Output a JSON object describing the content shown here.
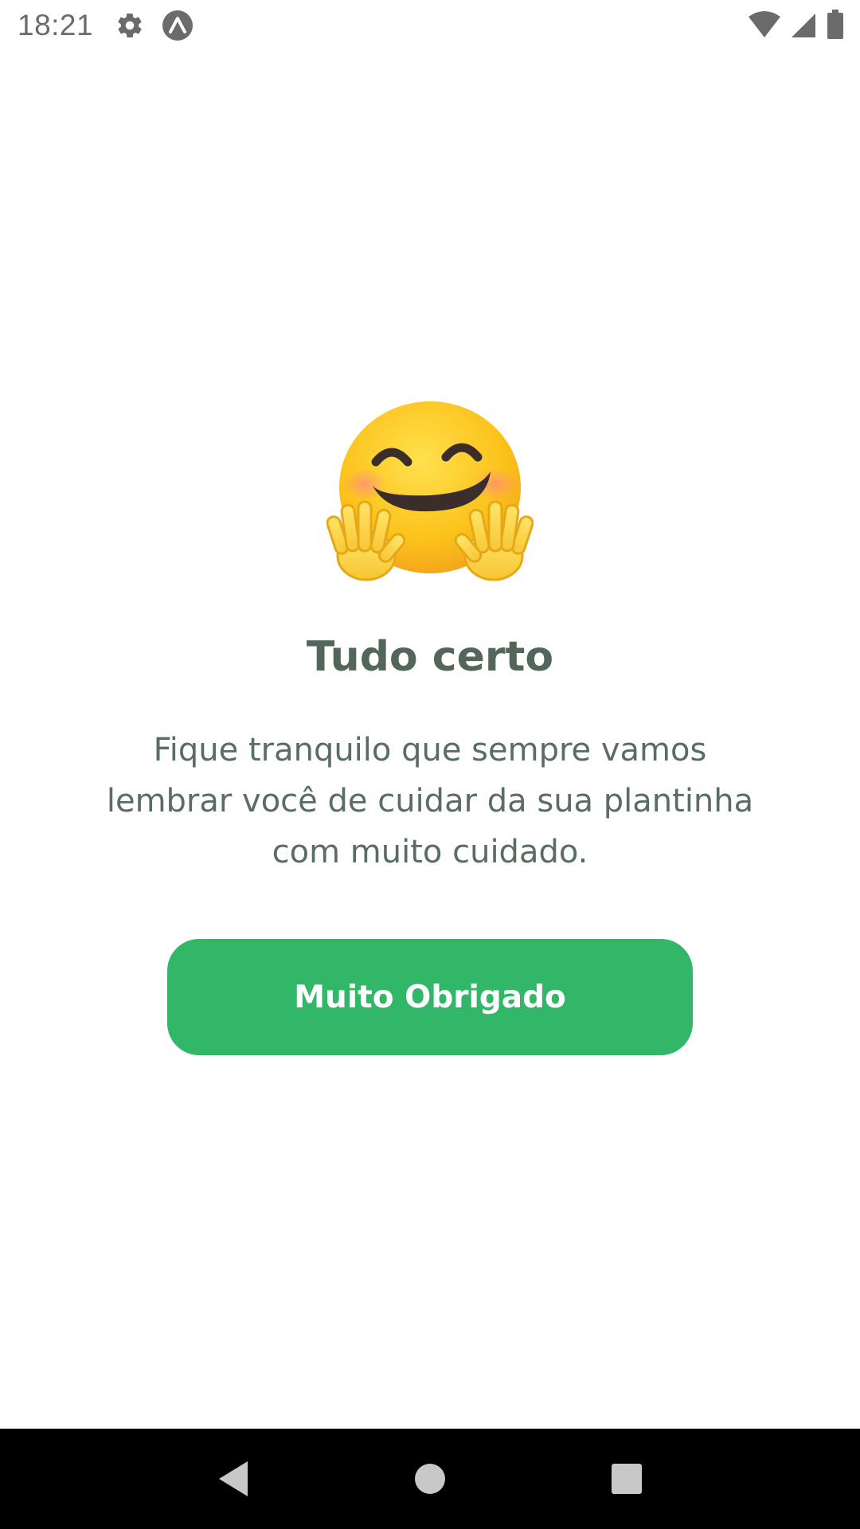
{
  "status_bar": {
    "time": "18:21",
    "icons": [
      "gear-icon",
      "expo-icon",
      "wifi-icon",
      "signal-icon",
      "battery-icon"
    ]
  },
  "main": {
    "emoji": "hugging-face",
    "title": "Tudo certo",
    "subtitle": "Fique tranquilo que sempre vamos lembrar você de cuidar da sua plantinha com muito cuidado.",
    "button_label": "Muito Obrigado"
  },
  "nav_bar": {
    "icons": [
      "back-icon",
      "home-icon",
      "recents-icon"
    ]
  },
  "colors": {
    "accent": "#32b768",
    "heading": "#52665a",
    "body_text": "#5a6d62"
  }
}
